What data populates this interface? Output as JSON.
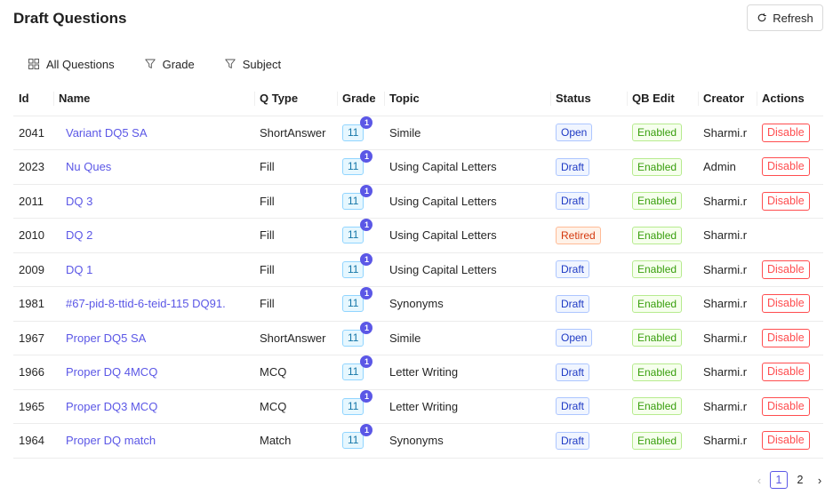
{
  "page": {
    "title": "Draft Questions"
  },
  "toolbar": {
    "refresh_label": "Refresh"
  },
  "filters": [
    {
      "label": "All Questions",
      "icon": "grid-icon"
    },
    {
      "label": "Grade",
      "icon": "filter-icon"
    },
    {
      "label": "Subject",
      "icon": "filter-icon"
    }
  ],
  "table": {
    "columns": [
      "Id",
      "Name",
      "Q Type",
      "Grade",
      "Topic",
      "Status",
      "QB Edit",
      "Creator",
      "Actions"
    ],
    "rows": [
      {
        "id": "2041",
        "name": "Variant DQ5 SA",
        "qtype": "ShortAnswer",
        "grade": "11",
        "badge": "1",
        "topic": "Simile",
        "status": "Open",
        "qbedit": "Enabled",
        "creator": "Sharmi.r",
        "action": "Disable"
      },
      {
        "id": "2023",
        "name": "Nu Ques",
        "qtype": "Fill",
        "grade": "11",
        "badge": "1",
        "topic": "Using Capital Letters",
        "status": "Draft",
        "qbedit": "Enabled",
        "creator": "Admin",
        "action": "Disable"
      },
      {
        "id": "2011",
        "name": "DQ 3",
        "qtype": "Fill",
        "grade": "11",
        "badge": "1",
        "topic": "Using Capital Letters",
        "status": "Draft",
        "qbedit": "Enabled",
        "creator": "Sharmi.r",
        "action": "Disable"
      },
      {
        "id": "2010",
        "name": "DQ 2",
        "qtype": "Fill",
        "grade": "11",
        "badge": "1",
        "topic": "Using Capital Letters",
        "status": "Retired",
        "qbedit": "Enabled",
        "creator": "Sharmi.r",
        "action": ""
      },
      {
        "id": "2009",
        "name": "DQ 1",
        "qtype": "Fill",
        "grade": "11",
        "badge": "1",
        "topic": "Using Capital Letters",
        "status": "Draft",
        "qbedit": "Enabled",
        "creator": "Sharmi.r",
        "action": "Disable"
      },
      {
        "id": "1981",
        "name": "#67-pid-8-ttid-6-teid-115 DQ91.",
        "qtype": "Fill",
        "grade": "11",
        "badge": "1",
        "topic": "Synonyms",
        "status": "Draft",
        "qbedit": "Enabled",
        "creator": "Sharmi.r",
        "action": "Disable"
      },
      {
        "id": "1967",
        "name": "Proper DQ5 SA",
        "qtype": "ShortAnswer",
        "grade": "11",
        "badge": "1",
        "topic": "Simile",
        "status": "Open",
        "qbedit": "Enabled",
        "creator": "Sharmi.r",
        "action": "Disable"
      },
      {
        "id": "1966",
        "name": "Proper DQ 4MCQ",
        "qtype": "MCQ",
        "grade": "11",
        "badge": "1",
        "topic": "Letter Writing",
        "status": "Draft",
        "qbedit": "Enabled",
        "creator": "Sharmi.r",
        "action": "Disable"
      },
      {
        "id": "1965",
        "name": "Proper DQ3 MCQ",
        "qtype": "MCQ",
        "grade": "11",
        "badge": "1",
        "topic": "Letter Writing",
        "status": "Draft",
        "qbedit": "Enabled",
        "creator": "Sharmi.r",
        "action": "Disable"
      },
      {
        "id": "1964",
        "name": "Proper DQ match",
        "qtype": "Match",
        "grade": "11",
        "badge": "1",
        "topic": "Synonyms",
        "status": "Draft",
        "qbedit": "Enabled",
        "creator": "Sharmi.r",
        "action": "Disable"
      }
    ]
  },
  "pagination": {
    "pages": [
      "1",
      "2"
    ],
    "current": "1",
    "prev_icon": "chevron-left-icon",
    "next_icon": "chevron-right-icon"
  },
  "colors": {
    "accent": "#5b57e6",
    "danger": "#ff4d4f",
    "success": "#389e0d",
    "retired": "#d4380d",
    "info": "#1d39c4"
  }
}
